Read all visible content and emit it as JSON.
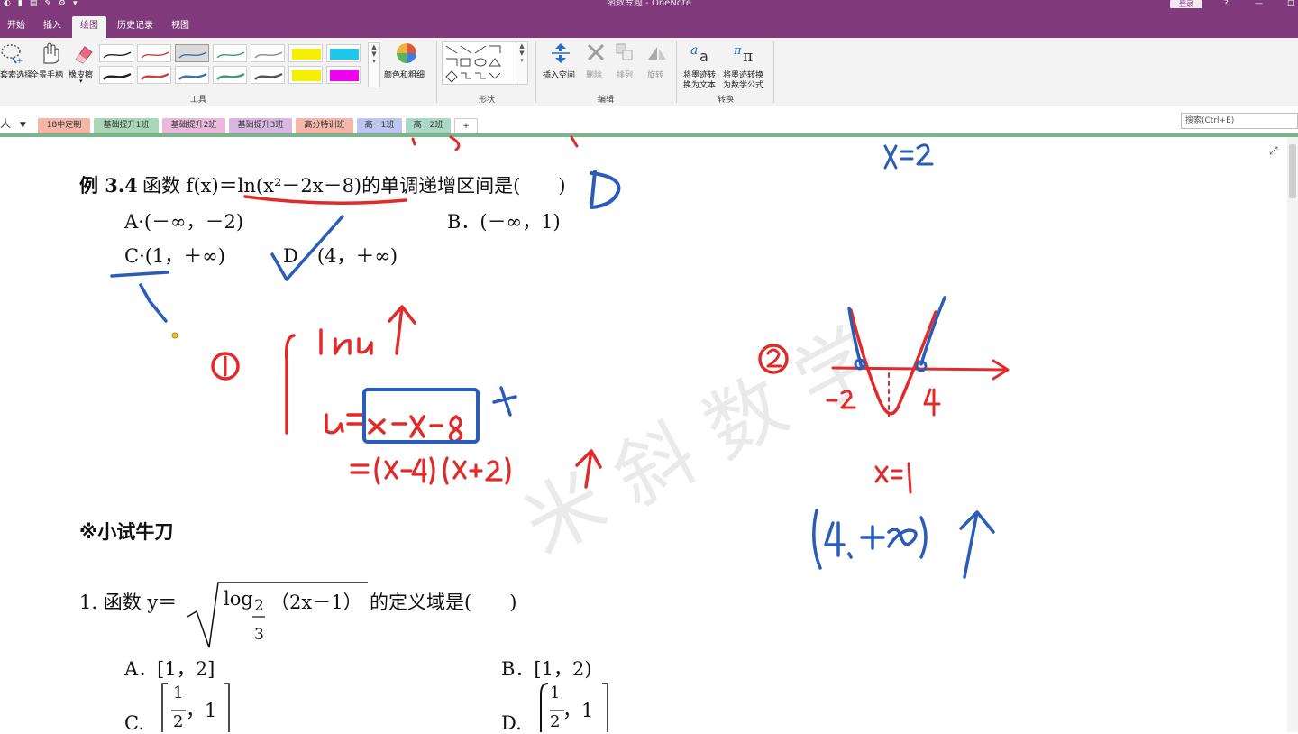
{
  "window": {
    "title": "函数专题 - OneNote",
    "login_label": "登录",
    "controls": [
      "?",
      "—",
      "□"
    ]
  },
  "ribbon_tabs": [
    "开始",
    "插入",
    "绘图",
    "历史记录",
    "视图"
  ],
  "active_tab": "绘图",
  "ribbon": {
    "lasso_label": "套索选择",
    "pan_label": "全景手柄",
    "eraser_label": "橡皮擦",
    "tools_group": "工具",
    "color_thickness_label": "颜色和粗细",
    "shapes_group": "形状",
    "insert_space_label": "插入空间",
    "delete_label": "删除",
    "arrange_label": "排列",
    "rotate_label": "旋转",
    "edit_group": "编辑",
    "ink_to_text_label_1": "将墨迹转",
    "ink_to_text_label_2": "换为文本",
    "ink_to_math_label_1": "将墨迹转换",
    "ink_to_math_label_2": "为数学公式",
    "convert_group": "转换",
    "pens": [
      {
        "color": "#222222"
      },
      {
        "color": "#d13c3c"
      },
      {
        "color": "#3b6fb5"
      },
      {
        "color": "#3e9b6a"
      },
      {
        "color": "#8a8a8a"
      },
      {
        "color": "#f5f000"
      },
      {
        "color": "#20c7e8"
      },
      {
        "color": "#222222"
      },
      {
        "color": "#d13c3c"
      },
      {
        "color": "#3b6fb5"
      },
      {
        "color": "#3e9b6a"
      },
      {
        "color": "#555555"
      },
      {
        "color": "#f5f000"
      },
      {
        "color": "#f000f0"
      }
    ]
  },
  "notebook": {
    "name": "人"
  },
  "section_tabs": [
    {
      "label": "18中定制",
      "color": "#f4b6a8"
    },
    {
      "label": "基础提升1班",
      "color": "#a9d8b8"
    },
    {
      "label": "基础提升2班",
      "color": "#e9b9dc"
    },
    {
      "label": "基础提升3班",
      "color": "#d9b8e0"
    },
    {
      "label": "高分特训班",
      "color": "#f4b6a8"
    },
    {
      "label": "高一1班",
      "color": "#bcc7ef"
    },
    {
      "label": "高一2班",
      "color": "#a9d8c4"
    },
    {
      "label": "+",
      "color": "#ffffff"
    }
  ],
  "search": {
    "placeholder": "搜索(Ctrl+E)"
  },
  "content": {
    "example_title": "例 3.4",
    "example_stem": "函数 f(x)＝ln(x²－2x－8)的单调递增区间是(　　)",
    "optA": "A·(－∞，－2)",
    "optB": "B．(－∞，1)",
    "optC": "C·(1，＋∞)",
    "optD": "D．(4，＋∞)",
    "practice_heading": "※小试牛刀",
    "q1_prefix": "1. 函数 y＝",
    "q1_log": "log",
    "q1_frac_num": "2",
    "q1_frac_den": "3",
    "q1_arg": "（2x－1）",
    "q1_suffix": "的定义域是(　　)",
    "q1_A": "A．[1，2]",
    "q1_B": "B．[1，2)",
    "q1_C_prefix": "C.",
    "q1_D_prefix": "D.",
    "q1_frac1_num": "1",
    "q1_frac1_den": "2",
    "q1_one": "，1"
  },
  "watermark": "米 斜 数 学"
}
